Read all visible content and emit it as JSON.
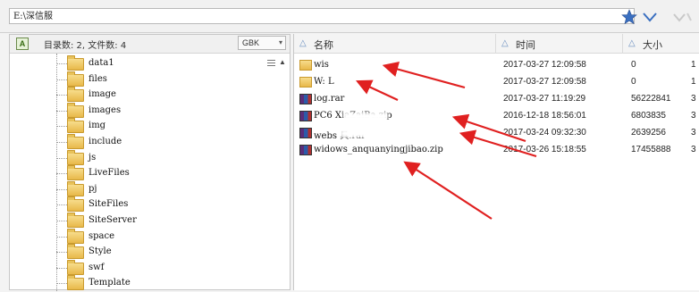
{
  "path_bar": {
    "path": "E:\\深信服",
    "star_icon": "star-icon",
    "dropdown_icon": "chevron-down-icon",
    "colors": {
      "accent": "#3a6fc0"
    }
  },
  "left_panel": {
    "counts": "目录数: 2, 文件数: 4",
    "encoding": "GBK",
    "folders": [
      "data1",
      "files",
      "image",
      "images",
      "img",
      "include",
      "js",
      "LiveFiles",
      "pj",
      "SiteFiles",
      "SiteServer",
      "space",
      "Style",
      "swf",
      "Template"
    ]
  },
  "right_panel": {
    "columns": {
      "name": "名称",
      "time": "时间",
      "size": "大小"
    },
    "files": [
      {
        "name": "wis",
        "time": "2017-03-27 12:09:58",
        "size": "0",
        "extra": "1",
        "icon": "folder"
      },
      {
        "name": "W:  L",
        "time": "2017-03-27 12:09:58",
        "size": "0",
        "extra": "1",
        "icon": "folder"
      },
      {
        "name": "log.rar",
        "time": "2017-03-27 11:19:29",
        "size": "56222841",
        "extra": "3",
        "icon": "archive"
      },
      {
        "name": "PC6        XiaZaiBa.zip",
        "time": "2016-12-18 18:56:01",
        "size": "6803835",
        "extra": "3",
        "icon": "archive"
      },
      {
        "name": "webs             具.rar",
        "time": "2017-03-24 09:32:30",
        "size": "2639256",
        "extra": "3",
        "icon": "archive"
      },
      {
        "name": "widows_anquanyingjibao.zip",
        "time": "2017-03-26 15:18:55",
        "size": "17455888",
        "extra": "3",
        "icon": "archive"
      }
    ]
  }
}
